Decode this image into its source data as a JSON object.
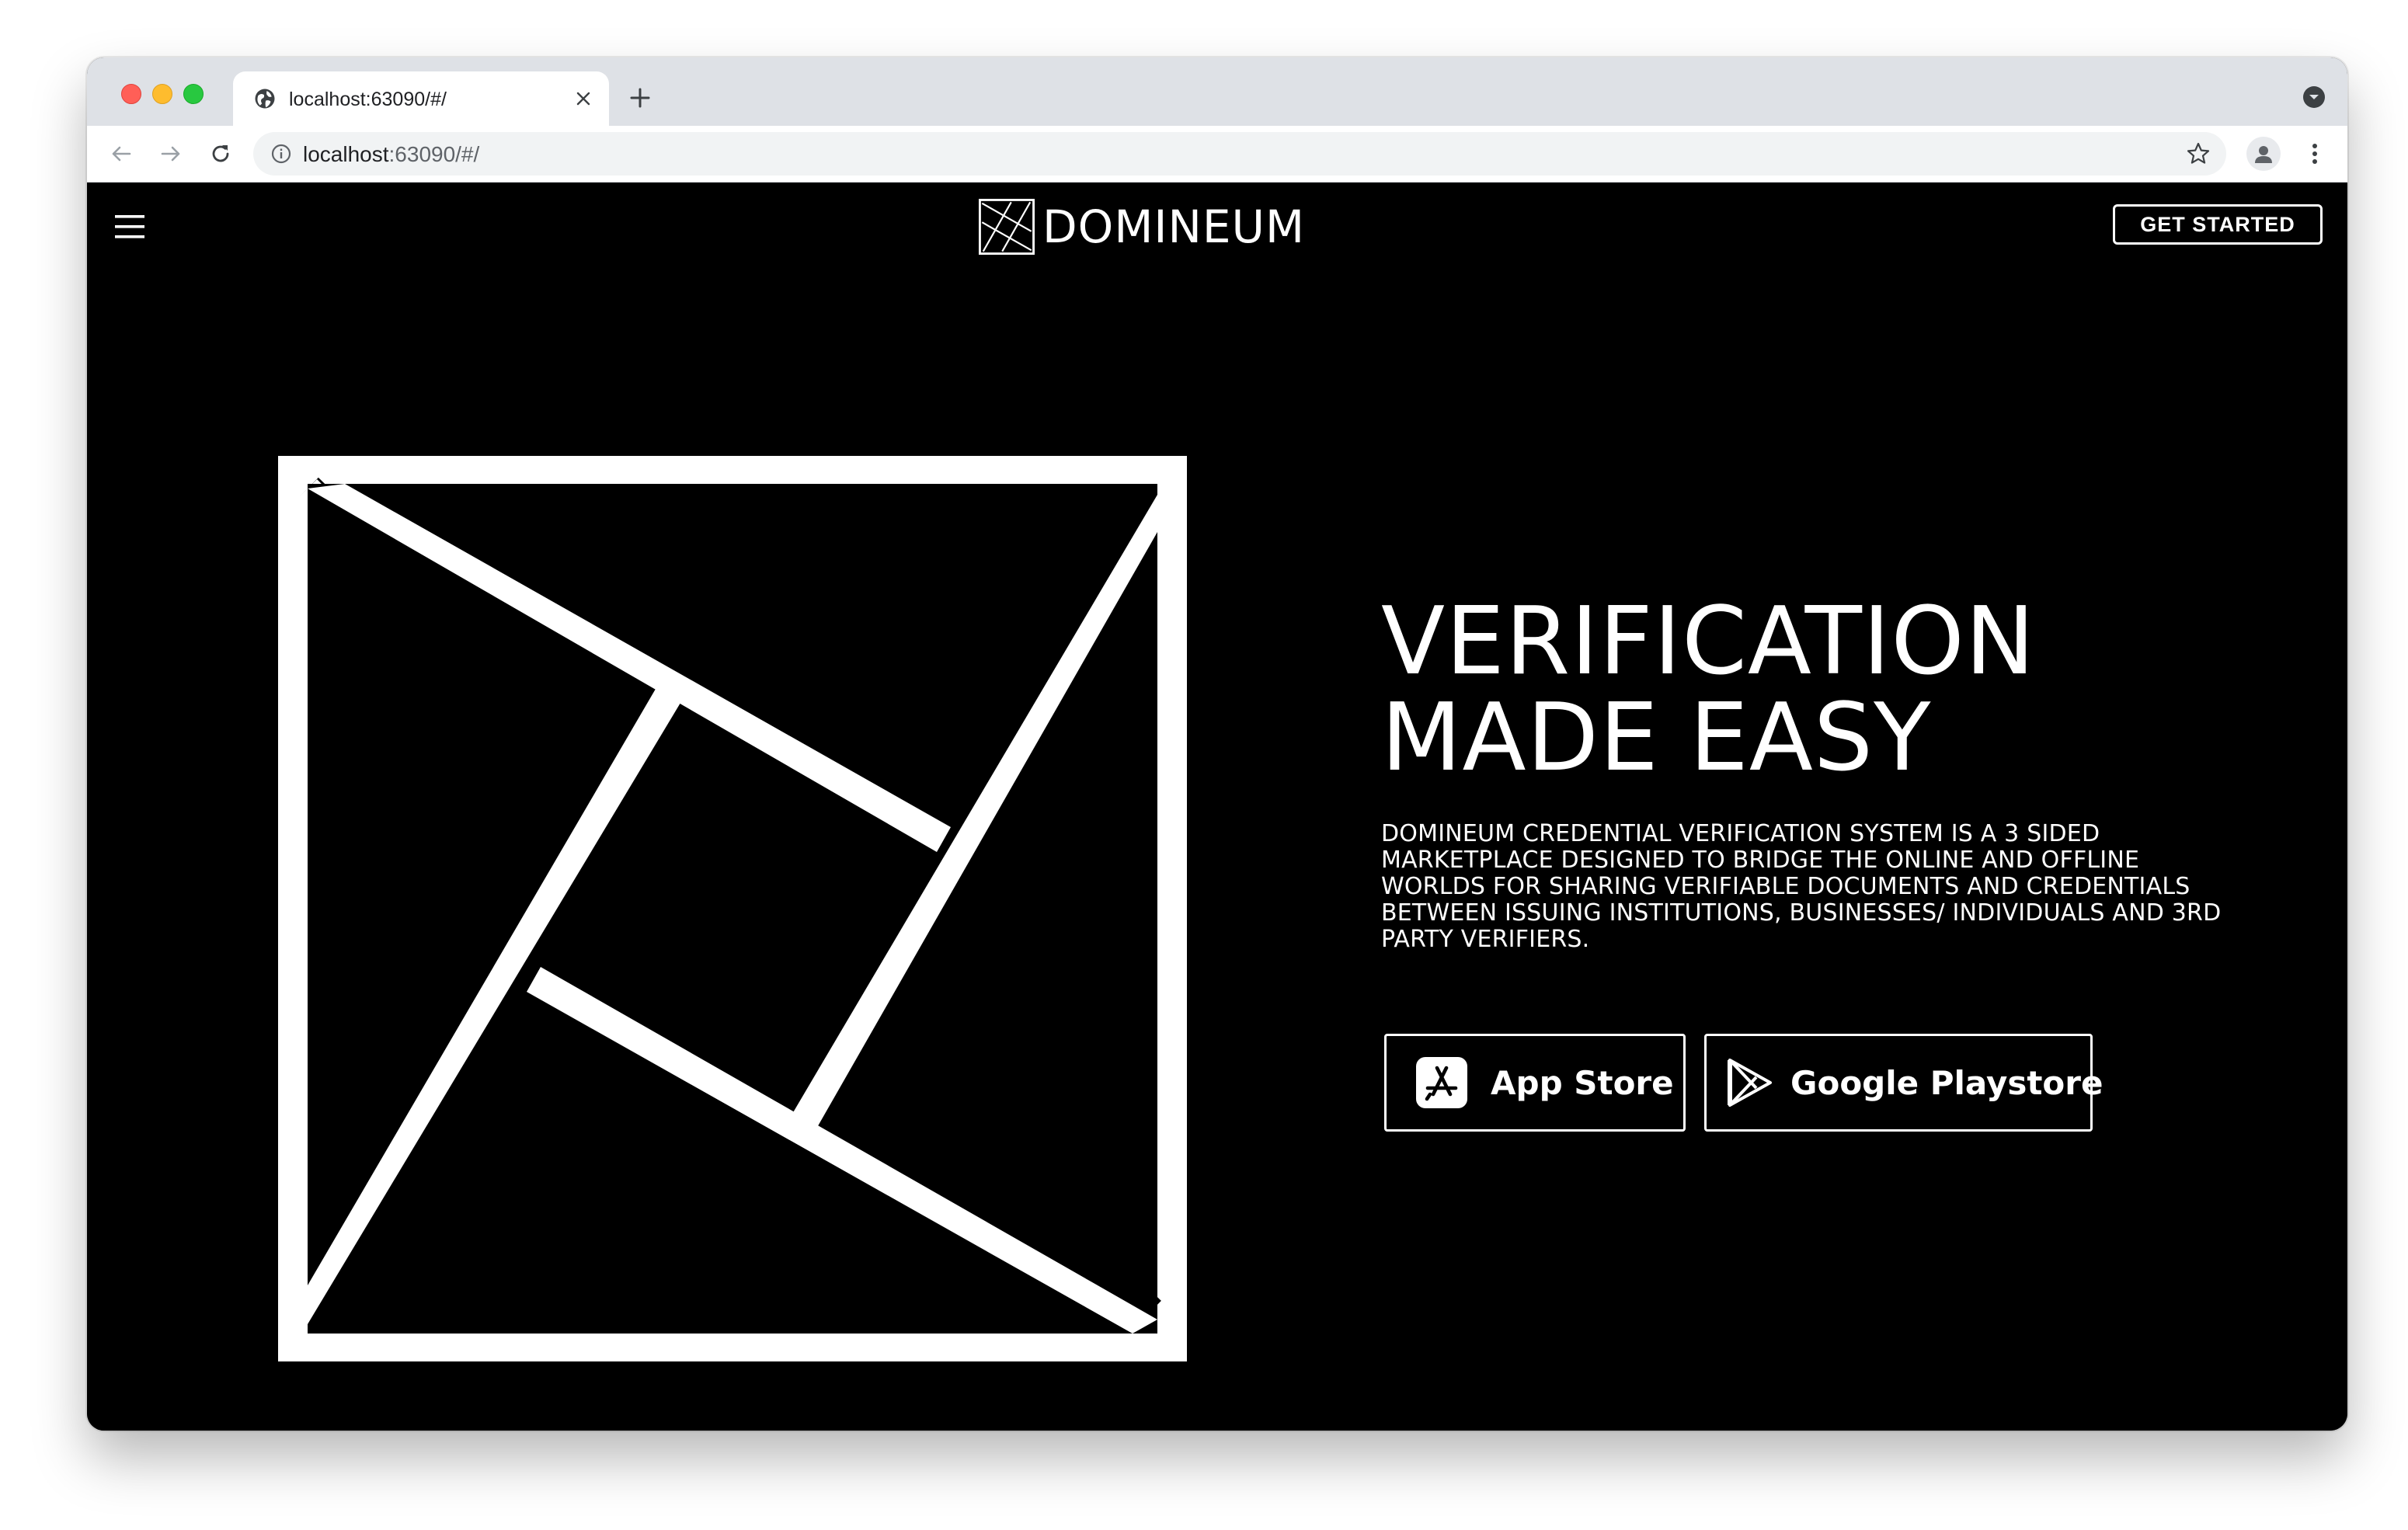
{
  "browser": {
    "tab": {
      "title": "localhost:63090/#/",
      "favicon_icon": "globe-icon"
    },
    "address_bar": {
      "host": "localhost",
      "rest": ":63090/#/"
    }
  },
  "header": {
    "brand_name": "DOMINEUM",
    "cta_label": "GET STARTED"
  },
  "hero": {
    "title_line1": "VERIFICATION",
    "title_line2": "MADE EASY",
    "description": "DOMINEUM CREDENTIAL VERIFICATION SYSTEM IS A 3 SIDED MARKETPLACE DESIGNED TO BRIDGE THE ONLINE AND OFFLINE WORLDS FOR SHARING VERIFIABLE DOCUMENTS AND CREDENTIALS BETWEEN ISSUING INSTITUTIONS, BUSINESSES/ INDIVIDUALS AND 3RD PARTY VERIFIERS.",
    "app_store_label": "App Store",
    "play_store_label": "Google Playstore"
  },
  "colors": {
    "page_background": "#000000",
    "foreground": "#ffffff",
    "tabstrip": "#dee1e6"
  }
}
